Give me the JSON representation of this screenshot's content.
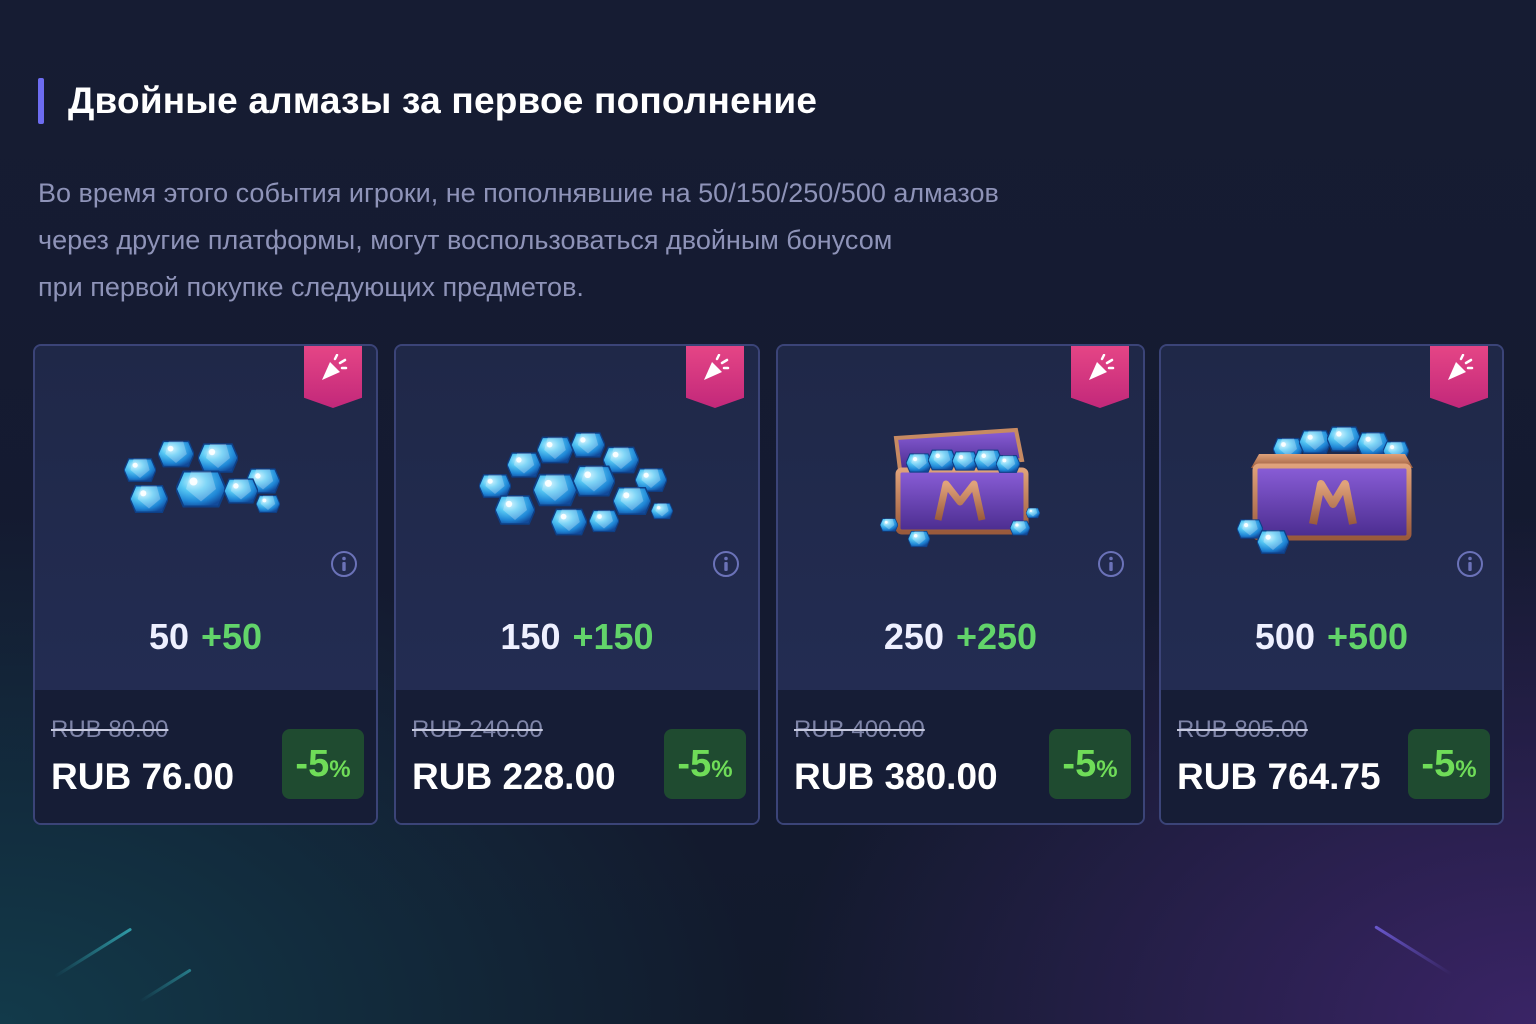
{
  "section": {
    "title": "Двойные алмазы за первое пополнение",
    "description_lines": [
      "Во время этого события игроки, не пополнявшие на 50/150/250/500 алмазов",
      "через другие платформы, могут воспользоваться двойным бонусом",
      "при первой покупке следующих предметов."
    ]
  },
  "colors": {
    "accent": "#6d6cf0",
    "bonus_green": "#62d46a",
    "ribbon_pink": "#e64686",
    "card_border": "#3b4478"
  },
  "cards": [
    {
      "base": "50",
      "bonus": "+50",
      "old_price": "RUB 80.00",
      "price": "RUB 76.00",
      "discount": "-5",
      "discount_unit": "%",
      "art": "small-diamond-pile-icon",
      "badge": "party-popper-icon"
    },
    {
      "base": "150",
      "bonus": "+150",
      "old_price": "RUB 240.00",
      "price": "RUB 228.00",
      "discount": "-5",
      "discount_unit": "%",
      "art": "large-diamond-pile-icon",
      "badge": "party-popper-icon"
    },
    {
      "base": "250",
      "bonus": "+250",
      "old_price": "RUB 400.00",
      "price": "RUB 380.00",
      "discount": "-5",
      "discount_unit": "%",
      "art": "open-diamond-chest-icon",
      "badge": "party-popper-icon"
    },
    {
      "base": "500",
      "bonus": "+500",
      "old_price": "RUB 805.00",
      "price": "RUB 764.75",
      "discount": "-5",
      "discount_unit": "%",
      "art": "full-diamond-chest-icon",
      "badge": "party-popper-icon"
    }
  ]
}
